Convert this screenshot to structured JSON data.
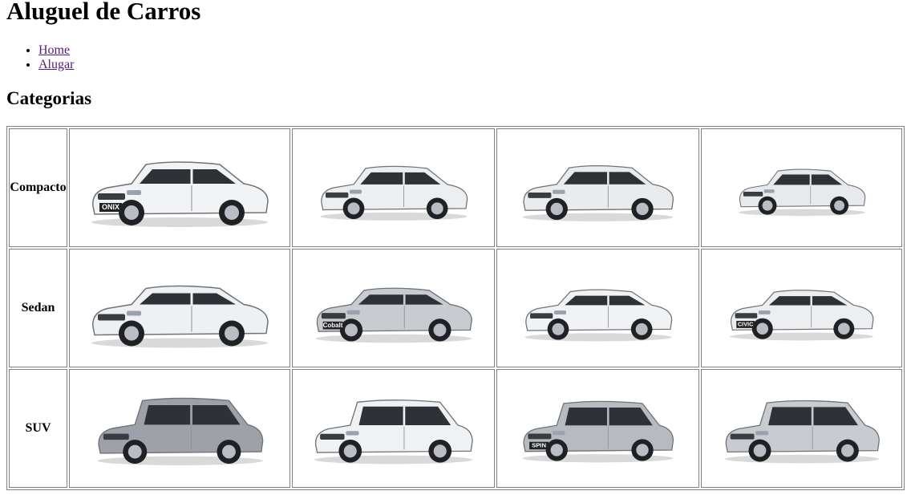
{
  "header": {
    "title": "Aluguel de Carros"
  },
  "nav": {
    "items": [
      {
        "label": "Home"
      },
      {
        "label": "Alugar"
      }
    ]
  },
  "section": {
    "title": "Categorias"
  },
  "categories": [
    {
      "label": "Compacto",
      "cars": [
        {
          "badge": "ONIX",
          "color": "#f2f3f5"
        },
        {
          "badge": "",
          "color": "#eceef0"
        },
        {
          "badge": "",
          "color": "#e9ebed"
        },
        {
          "badge": "",
          "color": "#e7e9ec"
        }
      ]
    },
    {
      "label": "Sedan",
      "cars": [
        {
          "badge": "",
          "color": "#eef0f3"
        },
        {
          "badge": "Cobalt",
          "color": "#c8ccd1"
        },
        {
          "badge": "",
          "color": "#f1f2f3"
        },
        {
          "badge": "CIVIC",
          "color": "#eceef0"
        }
      ]
    },
    {
      "label": "SUV",
      "cars": [
        {
          "badge": "",
          "color": "#9ea2a8"
        },
        {
          "badge": "",
          "color": "#eff1f2"
        },
        {
          "badge": "SPIN",
          "color": "#b7bbc1"
        },
        {
          "badge": "",
          "color": "#c8ccd1"
        }
      ]
    }
  ]
}
